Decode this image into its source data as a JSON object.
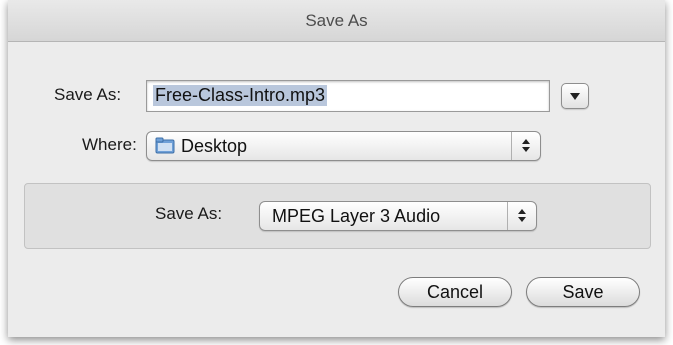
{
  "window": {
    "title": "Save As"
  },
  "form": {
    "save_as_label": "Save As:",
    "filename": "Free-Class-Intro.mp3",
    "where_label": "Where:",
    "where_value": "Desktop"
  },
  "format": {
    "label": "Save As:",
    "value": "MPEG Layer 3 Audio"
  },
  "buttons": {
    "cancel": "Cancel",
    "save": "Save"
  },
  "icons": {
    "folder": "folder-icon",
    "expand": "disclosure-triangle-icon",
    "stepper": "popup-stepper-icon"
  },
  "colors": {
    "selection_highlight": "#b9c7dc",
    "dialog_bg": "#ececec"
  }
}
